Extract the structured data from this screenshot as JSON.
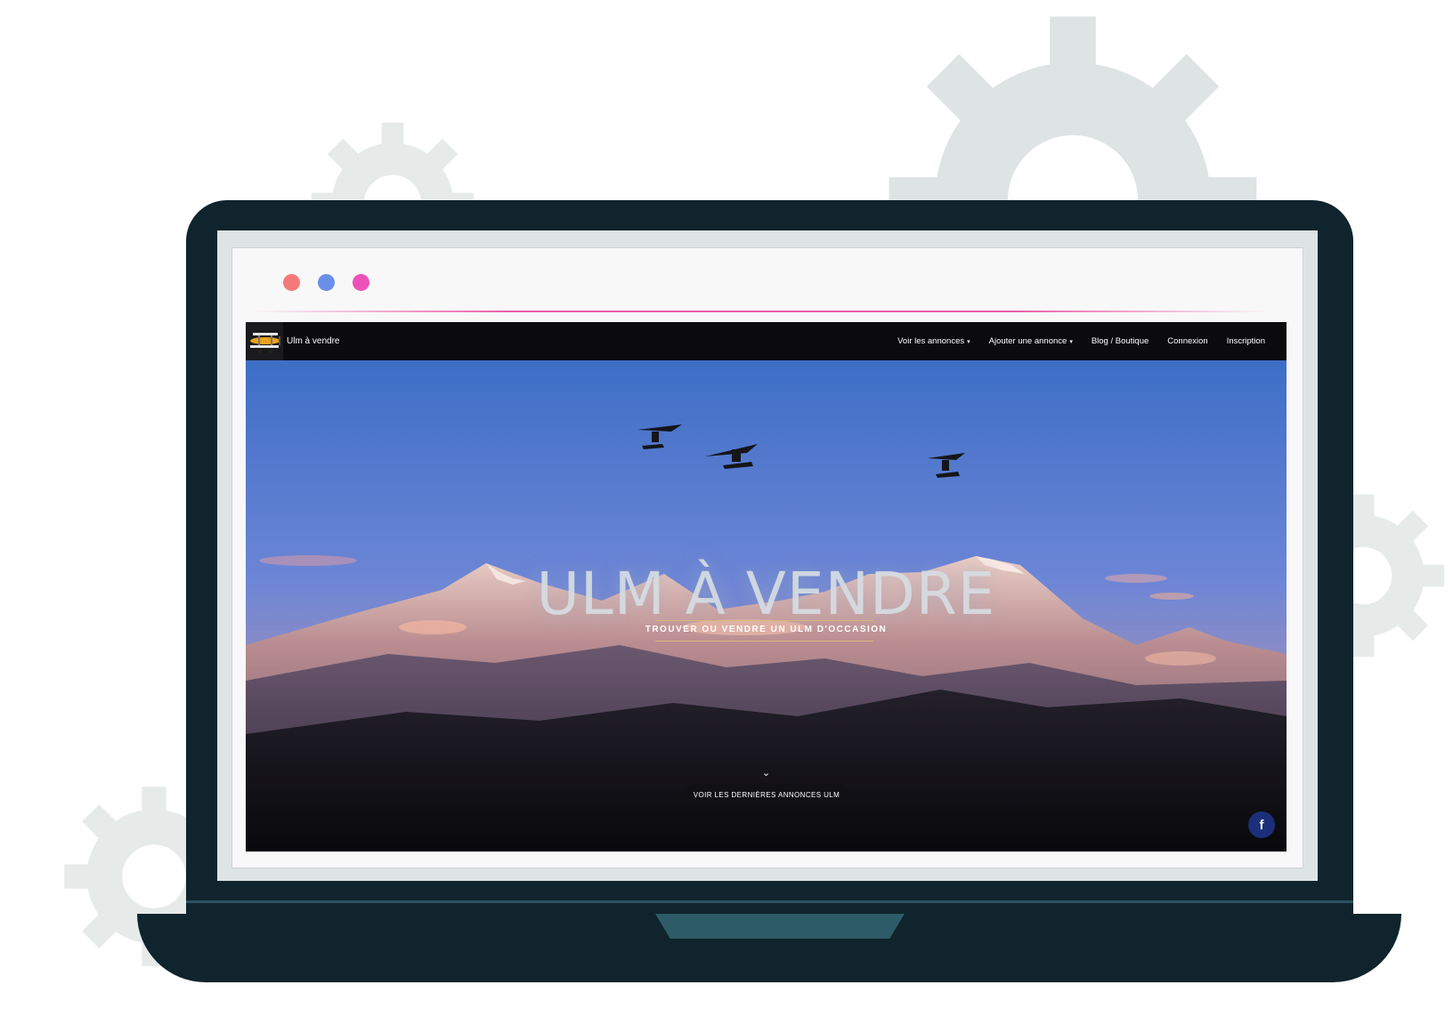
{
  "colors": {
    "laptop_body": "#0f242c",
    "bezel": "#dde4e3",
    "gear": "#dde4e3",
    "window_dot_red": "#f47a7a",
    "window_dot_blue": "#6b8fe8",
    "window_dot_pink": "#ec52b8",
    "nav_background": "#0b0b0d",
    "facebook_button": "#1b2f7a"
  },
  "navbar": {
    "brand_name": "Ulm à vendre",
    "items": [
      {
        "label": "Voir les annonces",
        "has_dropdown": true
      },
      {
        "label": "Ajouter une annonce",
        "has_dropdown": true
      },
      {
        "label": "Blog / Boutique",
        "has_dropdown": false
      },
      {
        "label": "Connexion",
        "has_dropdown": false
      },
      {
        "label": "Inscription",
        "has_dropdown": false
      }
    ],
    "dropdown_caret": "▾"
  },
  "hero": {
    "title": "ULM À VENDRE",
    "subtitle": "TROUVER OU VENDRE UN ULM D'OCCASION",
    "scroll_chevron": "⌄",
    "cta_label": "VOIR LES DERNIÈRES ANNONCES ULM"
  },
  "social": {
    "facebook_glyph": "f",
    "facebook_icon": "facebook-icon"
  },
  "icons": [
    "gear-icon",
    "window-dot",
    "biplane-logo-icon",
    "chevron-down-icon",
    "facebook-icon"
  ]
}
